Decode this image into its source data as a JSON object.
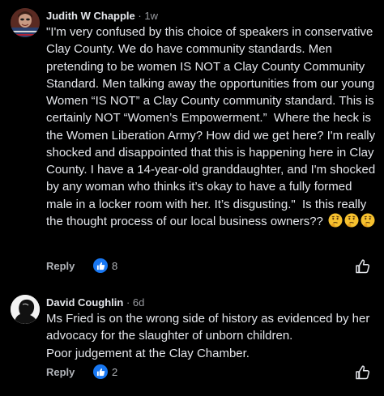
{
  "comments": [
    {
      "author": "Judith W Chapple",
      "separator": " · ",
      "time": "1w",
      "text": "\"I'm very confused by this choice of speakers in conservative Clay County. We do have community standards. Men pretending to be women IS NOT a Clay County Community Standard. Men talking away the opportunities from our young Women “IS NOT” a Clay County community standard. This is certainly NOT “Women’s Empowerment.”  Where the heck is the Women Liberation Army? How did we get here? I'm really shocked and disappointed that this is happening here in Clay County. I have a 14-year-old granddaughter, and I'm shocked by any woman who thinks it’s okay to have a fully formed male in a locker room with her. It’s disgusting.\"  Is this really the thought process of our local business owners?? ",
      "emojis": [
        "thinking-face",
        "thinking-face",
        "thinking-face"
      ],
      "reply_label": "Reply",
      "reaction_count": "8",
      "avatar": "profile-photo"
    },
    {
      "author": "David Coughlin",
      "separator": " · ",
      "time": "6d",
      "text": "Ms Fried is on the wrong side of history as evidenced by her advocacy for the slaughter of unborn children.\nPoor judgement at the Clay Chamber.",
      "reply_label": "Reply",
      "reaction_count": "2",
      "avatar": "silhouette-photo"
    }
  ],
  "colors": {
    "background": "#000000",
    "text": "#e4e6eb",
    "muted": "#b0b3b8",
    "like_blue": "#1877f2"
  }
}
